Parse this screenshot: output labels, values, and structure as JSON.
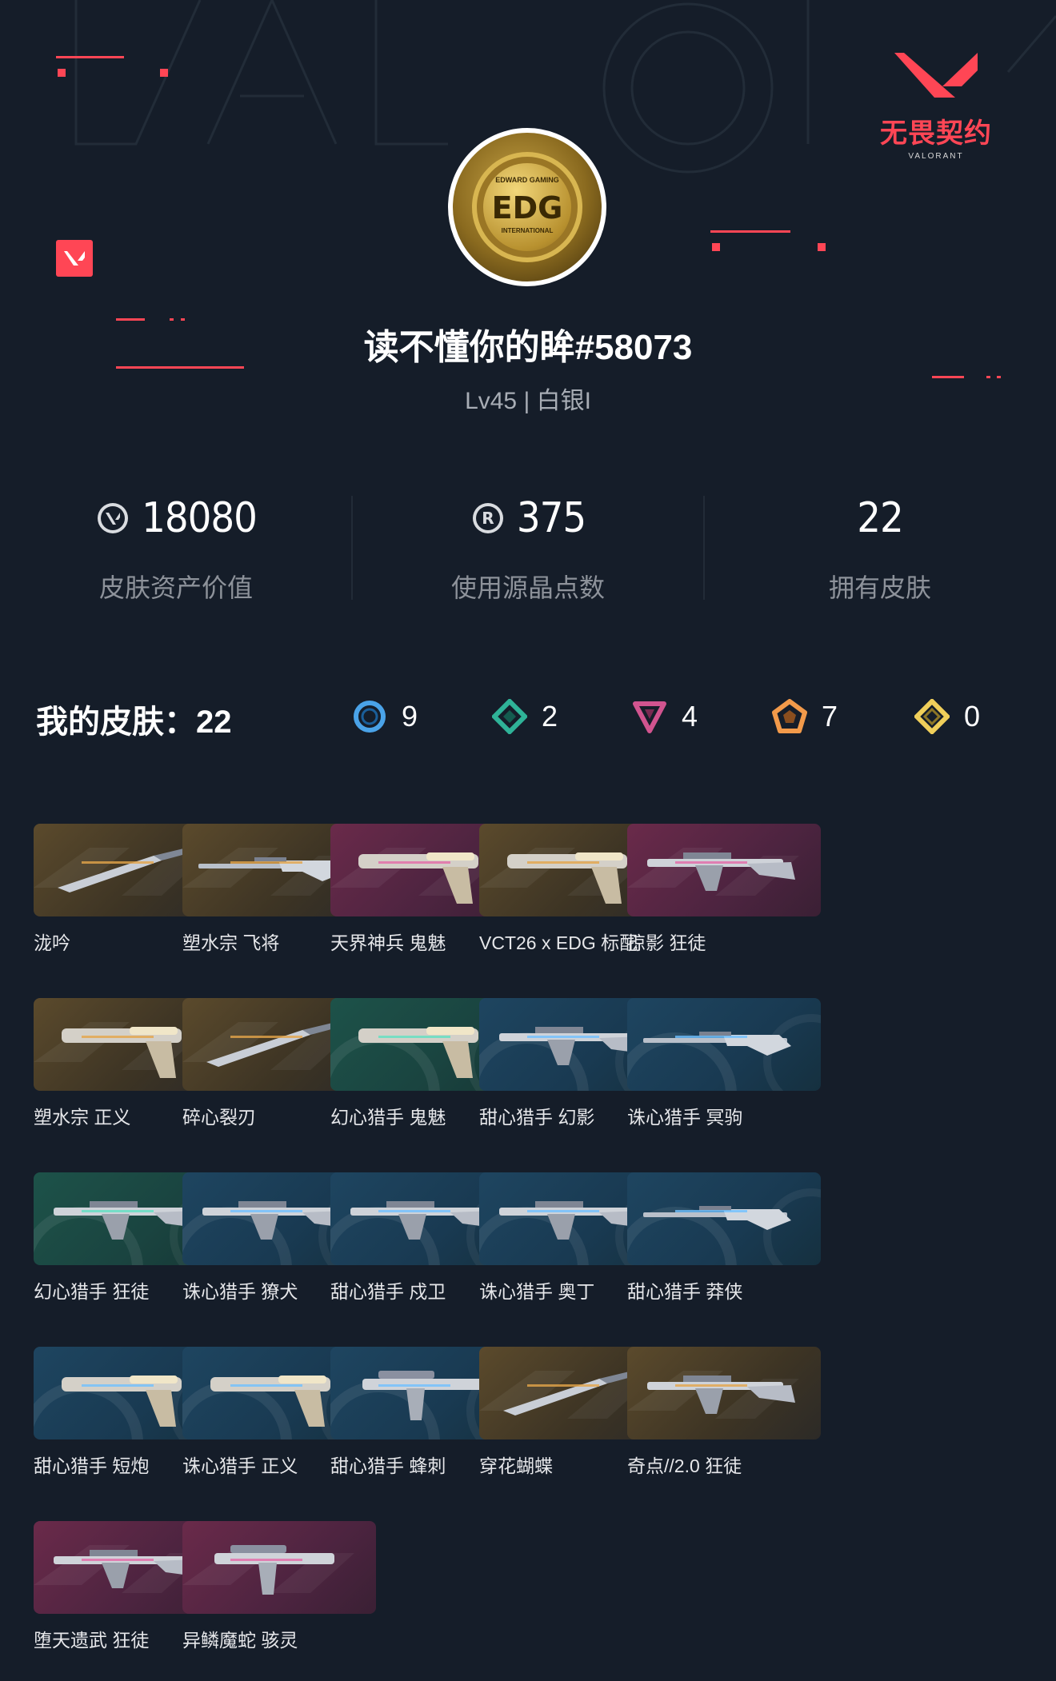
{
  "brand": {
    "name": "无畏契约",
    "sub": "VALORANT"
  },
  "avatar": {
    "top": "EDWARD GAMING",
    "main": "EDG",
    "bottom": "INTERNATIONAL"
  },
  "profile": {
    "username": "读不懂你的眸#58073",
    "level": "Lv45 | 白银I"
  },
  "stats": [
    {
      "icon": "valorant-points-icon",
      "value": "18080",
      "label": "皮肤资产价值"
    },
    {
      "icon": "radianite-icon",
      "value": "375",
      "label": "使用源晶点数"
    },
    {
      "icon": "",
      "value": "22",
      "label": "拥有皮肤"
    }
  ],
  "skins_header": {
    "title": "我的皮肤：22"
  },
  "tiers": [
    {
      "icon": "select-tier-icon",
      "color": "#4aa3e8",
      "count": "9"
    },
    {
      "icon": "deluxe-tier-icon",
      "color": "#2fb398",
      "count": "2"
    },
    {
      "icon": "premium-tier-icon",
      "color": "#d1548f",
      "count": "4"
    },
    {
      "icon": "exclusive-tier-icon",
      "color": "#f29a4a",
      "count": "7"
    },
    {
      "icon": "ultra-tier-icon",
      "color": "#f0cf5a",
      "count": "0"
    }
  ],
  "skins": [
    {
      "name": "泷吟",
      "tier": "gold",
      "weapon": "knife"
    },
    {
      "name": "塑水宗 飞将",
      "tier": "gold",
      "weapon": "sniper"
    },
    {
      "name": "天界神兵 鬼魅",
      "tier": "pink",
      "weapon": "pistol"
    },
    {
      "name": "VCT26 x EDG 标配",
      "tier": "gold",
      "weapon": "pistol"
    },
    {
      "name": "掠影 狂徒",
      "tier": "pink",
      "weapon": "rifle"
    },
    {
      "name": "塑水宗 正义",
      "tier": "gold",
      "weapon": "pistol"
    },
    {
      "name": "碎心裂刃",
      "tier": "gold",
      "weapon": "knife"
    },
    {
      "name": "幻心猎手 鬼魅",
      "tier": "green",
      "weapon": "pistol"
    },
    {
      "name": "甜心猎手 幻影",
      "tier": "blue",
      "weapon": "rifle"
    },
    {
      "name": "诛心猎手 冥驹",
      "tier": "blue",
      "weapon": "sniper"
    },
    {
      "name": "幻心猎手 狂徒",
      "tier": "green",
      "weapon": "rifle"
    },
    {
      "name": "诛心猎手 獠犬",
      "tier": "blue",
      "weapon": "rifle"
    },
    {
      "name": "甜心猎手 戍卫",
      "tier": "blue",
      "weapon": "rifle"
    },
    {
      "name": "诛心猎手 奥丁",
      "tier": "blue",
      "weapon": "rifle"
    },
    {
      "name": "甜心猎手 莽侠",
      "tier": "blue",
      "weapon": "sniper"
    },
    {
      "name": "甜心猎手 短炮",
      "tier": "blue",
      "weapon": "pistol"
    },
    {
      "name": "诛心猎手 正义",
      "tier": "blue",
      "weapon": "pistol"
    },
    {
      "name": "甜心猎手 蜂刺",
      "tier": "blue",
      "weapon": "smg"
    },
    {
      "name": "穿花蝴蝶",
      "tier": "gold",
      "weapon": "knife"
    },
    {
      "name": "奇点//2.0 狂徒",
      "tier": "gold",
      "weapon": "rifle"
    },
    {
      "name": "堕天遗武 狂徒",
      "tier": "pink",
      "weapon": "rifle"
    },
    {
      "name": "异鳞魔蛇 骇灵",
      "tier": "pink",
      "weapon": "smg"
    }
  ]
}
